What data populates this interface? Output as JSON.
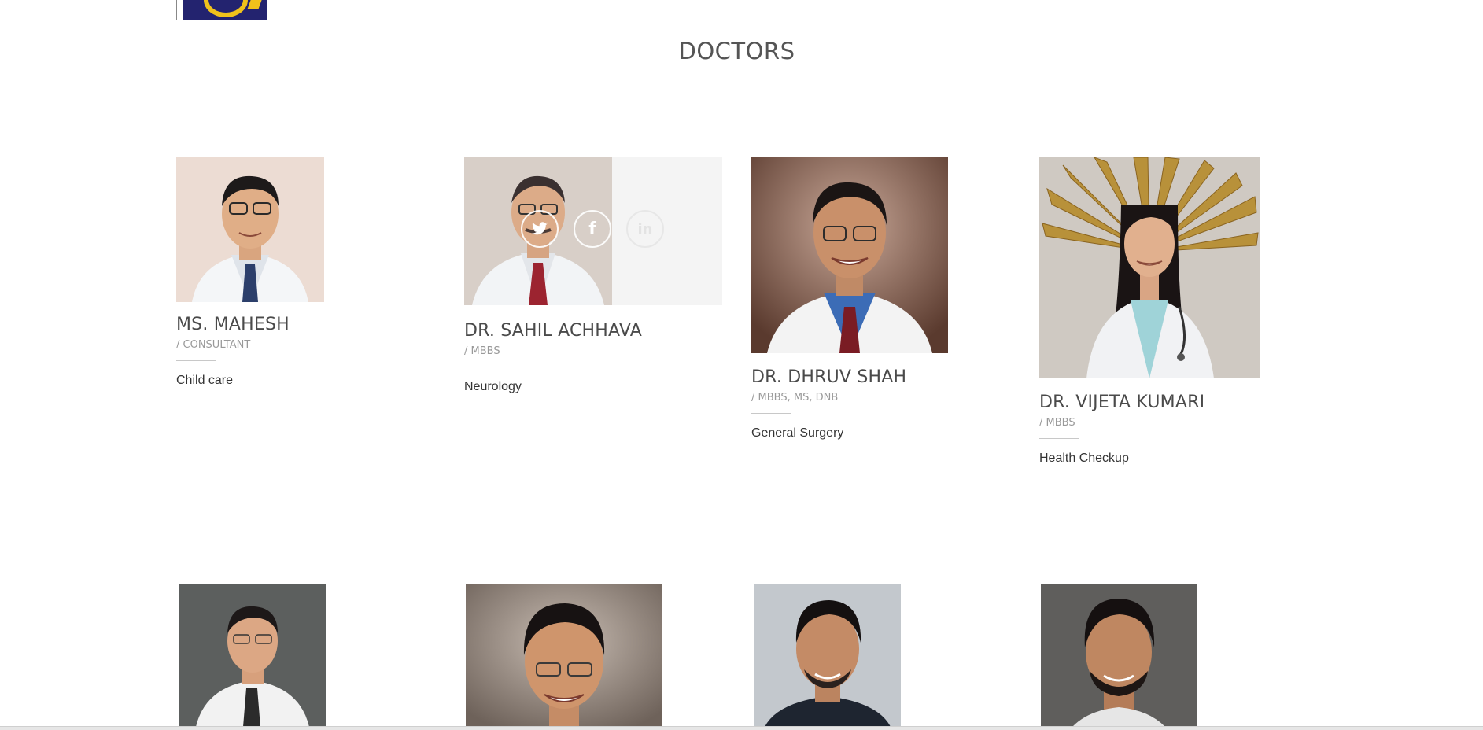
{
  "section": {
    "title": "DOCTORS"
  },
  "doctors": [
    {
      "name": "MS. MAHESH",
      "degree": "/ CONSULTANT",
      "specialty": "Child care"
    },
    {
      "name": "DR. SAHIL ACHHAVA",
      "degree": "/ MBBS",
      "specialty": "Neurology"
    },
    {
      "name": "DR. DHRUV SHAH",
      "degree": "/ MBBS, MS, DNB",
      "specialty": "General Surgery"
    },
    {
      "name": "DR. VIJETA KUMARI",
      "degree": "/ MBBS",
      "specialty": "Health Checkup"
    }
  ],
  "social_icons": [
    "twitter-icon",
    "facebook-icon",
    "linkedin-icon"
  ],
  "social_glyphs": {
    "twitter": "🐦",
    "facebook": "f",
    "linkedin": "in"
  },
  "colors": {
    "title": "#555555",
    "name": "#4a4a4a",
    "degree": "#999999",
    "logo_navy": "#23236f",
    "logo_gold": "#f0c21b"
  }
}
